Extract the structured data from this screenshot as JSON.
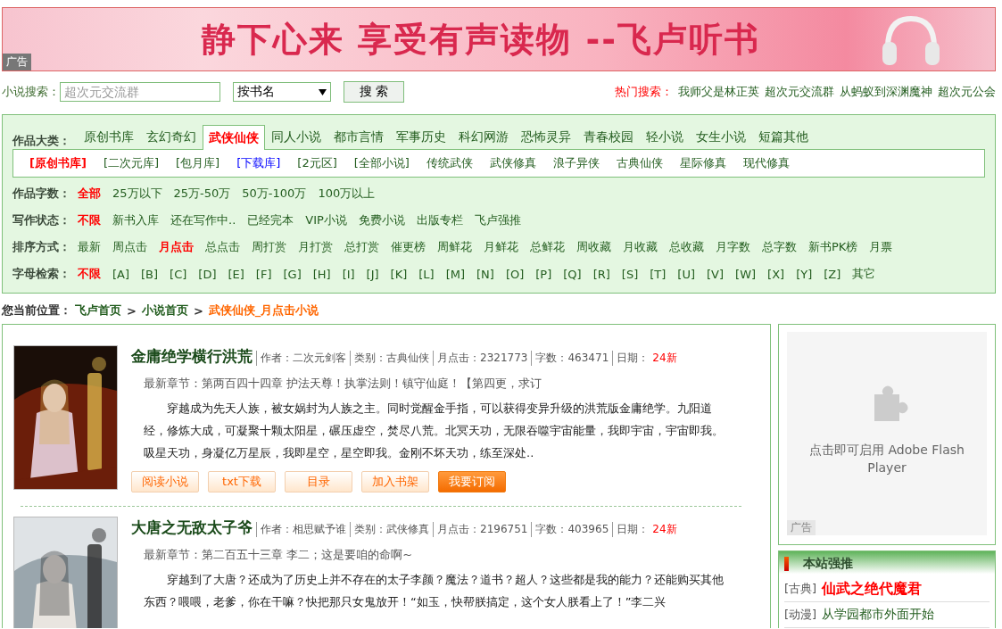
{
  "banner": {
    "slogan": "静下心来 享受有声读物 --飞卢听书",
    "ad_label": "广告"
  },
  "search": {
    "label": "小说搜索：",
    "placeholder": "超次元交流群",
    "select": "按书名",
    "button": "搜 索"
  },
  "hot_search": {
    "label": "热门搜索：",
    "items": [
      "我师父是林正英",
      "超次元交流群",
      "从蚂蚁到深渊魔神",
      "超次元公会"
    ]
  },
  "categories": {
    "label": "作品大类：",
    "items": [
      {
        "label": "原创书库",
        "selected": false
      },
      {
        "label": "玄幻奇幻",
        "selected": false
      },
      {
        "label": "武侠仙侠",
        "selected": true
      },
      {
        "label": "同人小说",
        "selected": false
      },
      {
        "label": "都市言情",
        "selected": false
      },
      {
        "label": "军事历史",
        "selected": false
      },
      {
        "label": "科幻网游",
        "selected": false
      },
      {
        "label": "恐怖灵异",
        "selected": false
      },
      {
        "label": "青春校园",
        "selected": false
      },
      {
        "label": "轻小说",
        "selected": false
      },
      {
        "label": "女生小说",
        "selected": false
      },
      {
        "label": "短篇其他",
        "selected": false
      }
    ]
  },
  "subcategories": [
    {
      "label": "[原创书库]",
      "selected": true,
      "kind": "plain"
    },
    {
      "label": "[二次元库]",
      "selected": false,
      "kind": "plain"
    },
    {
      "label": "[包月库]",
      "selected": false,
      "kind": "plain"
    },
    {
      "label": "[下载库]",
      "selected": false,
      "kind": "special"
    },
    {
      "label": "[2元区]",
      "selected": false,
      "kind": "plain"
    },
    {
      "label": "[全部小说]",
      "selected": false,
      "kind": "plain"
    },
    {
      "label": "传统武侠",
      "selected": false,
      "kind": "plain"
    },
    {
      "label": "武侠修真",
      "selected": false,
      "kind": "plain"
    },
    {
      "label": "浪子异侠",
      "selected": false,
      "kind": "plain"
    },
    {
      "label": "古典仙侠",
      "selected": false,
      "kind": "plain"
    },
    {
      "label": "星际修真",
      "selected": false,
      "kind": "plain"
    },
    {
      "label": "现代修真",
      "selected": false,
      "kind": "plain"
    }
  ],
  "filters": [
    {
      "label": "作品字数：",
      "options": [
        {
          "label": "全部",
          "selected": true
        },
        {
          "label": "25万以下",
          "selected": false
        },
        {
          "label": "25万-50万",
          "selected": false
        },
        {
          "label": "50万-100万",
          "selected": false
        },
        {
          "label": "100万以上",
          "selected": false
        }
      ]
    },
    {
      "label": "写作状态：",
      "options": [
        {
          "label": "不限",
          "selected": true
        },
        {
          "label": "新书入库",
          "selected": false
        },
        {
          "label": "还在写作中..",
          "selected": false
        },
        {
          "label": "已经完本",
          "selected": false
        },
        {
          "label": "VIP小说",
          "selected": false
        },
        {
          "label": "免费小说",
          "selected": false
        },
        {
          "label": "出版专栏",
          "selected": false
        },
        {
          "label": "飞卢强推",
          "selected": false
        }
      ]
    },
    {
      "label": "排序方式：",
      "options": [
        {
          "label": "最新",
          "selected": false
        },
        {
          "label": "周点击",
          "selected": false
        },
        {
          "label": "月点击",
          "selected": true
        },
        {
          "label": "总点击",
          "selected": false
        },
        {
          "label": "周打赏",
          "selected": false
        },
        {
          "label": "月打赏",
          "selected": false
        },
        {
          "label": "总打赏",
          "selected": false
        },
        {
          "label": "催更榜",
          "selected": false
        },
        {
          "label": "周鲜花",
          "selected": false
        },
        {
          "label": "月鲜花",
          "selected": false
        },
        {
          "label": "总鲜花",
          "selected": false
        },
        {
          "label": "周收藏",
          "selected": false
        },
        {
          "label": "月收藏",
          "selected": false
        },
        {
          "label": "总收藏",
          "selected": false
        },
        {
          "label": "月字数",
          "selected": false
        },
        {
          "label": "总字数",
          "selected": false
        },
        {
          "label": "新书PK榜",
          "selected": false
        },
        {
          "label": "月票",
          "selected": false
        }
      ]
    },
    {
      "label": "字母检索：",
      "options": [
        {
          "label": "不限",
          "selected": true
        },
        {
          "label": "[A]",
          "selected": false
        },
        {
          "label": "[B]",
          "selected": false
        },
        {
          "label": "[C]",
          "selected": false
        },
        {
          "label": "[D]",
          "selected": false
        },
        {
          "label": "[E]",
          "selected": false
        },
        {
          "label": "[F]",
          "selected": false
        },
        {
          "label": "[G]",
          "selected": false
        },
        {
          "label": "[H]",
          "selected": false
        },
        {
          "label": "[I]",
          "selected": false
        },
        {
          "label": "[J]",
          "selected": false
        },
        {
          "label": "[K]",
          "selected": false
        },
        {
          "label": "[L]",
          "selected": false
        },
        {
          "label": "[M]",
          "selected": false
        },
        {
          "label": "[N]",
          "selected": false
        },
        {
          "label": "[O]",
          "selected": false
        },
        {
          "label": "[P]",
          "selected": false
        },
        {
          "label": "[Q]",
          "selected": false
        },
        {
          "label": "[R]",
          "selected": false
        },
        {
          "label": "[S]",
          "selected": false
        },
        {
          "label": "[T]",
          "selected": false
        },
        {
          "label": "[U]",
          "selected": false
        },
        {
          "label": "[V]",
          "selected": false
        },
        {
          "label": "[W]",
          "selected": false
        },
        {
          "label": "[X]",
          "selected": false
        },
        {
          "label": "[Y]",
          "selected": false
        },
        {
          "label": "[Z]",
          "selected": false
        },
        {
          "label": "其它",
          "selected": false
        }
      ]
    }
  ],
  "breadcrumb": {
    "label": "您当前位置：",
    "links": [
      "飞卢首页",
      "小说首页"
    ],
    "separator": ">",
    "current": "武侠仙侠_月点击小说"
  },
  "books": [
    {
      "cover": {
        "kind": "picture"
      },
      "title": "金庸绝学横行洪荒",
      "meta": [
        "作者：二次元剑客",
        "类别：古典仙侠",
        "月点击：2321773",
        "字数：463471"
      ],
      "date_label": "日期：",
      "date": "24新",
      "latest": "最新章节：第两百四十四章 护法天尊！执掌法则！镇守仙庭！【第四更，求订",
      "description": "穿越成为先天人族，被女娲封为人族之主。同时觉醒金手指，可以获得变异升级的洪荒版金庸绝学。九阳道经，修炼大成，可凝聚十颗太阳星，碾压虚空，焚尽八荒。北冥天功，无限吞噬宇宙能量，我即宇宙，宇宙即我。吸星天功，身凝亿万星辰，我即星空，星空即我。金刚不坏天功，练至深处..",
      "buttons": [
        {
          "label": "阅读小说",
          "kind": "normal"
        },
        {
          "label": "txt下载",
          "kind": "normal"
        },
        {
          "label": "目录",
          "kind": "normal"
        },
        {
          "label": "加入书架",
          "kind": "normal"
        },
        {
          "label": "我要订阅",
          "kind": "primary"
        }
      ]
    },
    {
      "cover": {
        "kind": "picture"
      },
      "title": "大唐之无敌太子爷",
      "meta": [
        "作者：相思赋予谁",
        "类别：武侠修真",
        "月点击：2196751",
        "字数：403965"
      ],
      "date_label": "日期：",
      "date": "24新",
      "latest": "最新章节：第二百五十三章 李二；这是要咱的命啊~",
      "description": "穿越到了大唐？还成为了历史上并不存在的太子李颜？魔法？道书？超人？这些都是我的能力？还能购买其他东西？喂喂，老爹，你在干嘛？快把那只女鬼放开！“如玉，快帮朕搞定，这个女人朕看上了！”李二兴"
    }
  ],
  "sidebar": {
    "flash": {
      "message": "点击即可启用 Adobe Flash Player",
      "ad_label": "广告"
    },
    "recommend": {
      "title": "本站强推",
      "items": [
        {
          "tag": "[古典]",
          "title": "仙武之绝代魔君",
          "featured": true
        },
        {
          "tag": "[动漫]",
          "title": "从学园都市外面开始",
          "featured": false
        }
      ]
    }
  }
}
